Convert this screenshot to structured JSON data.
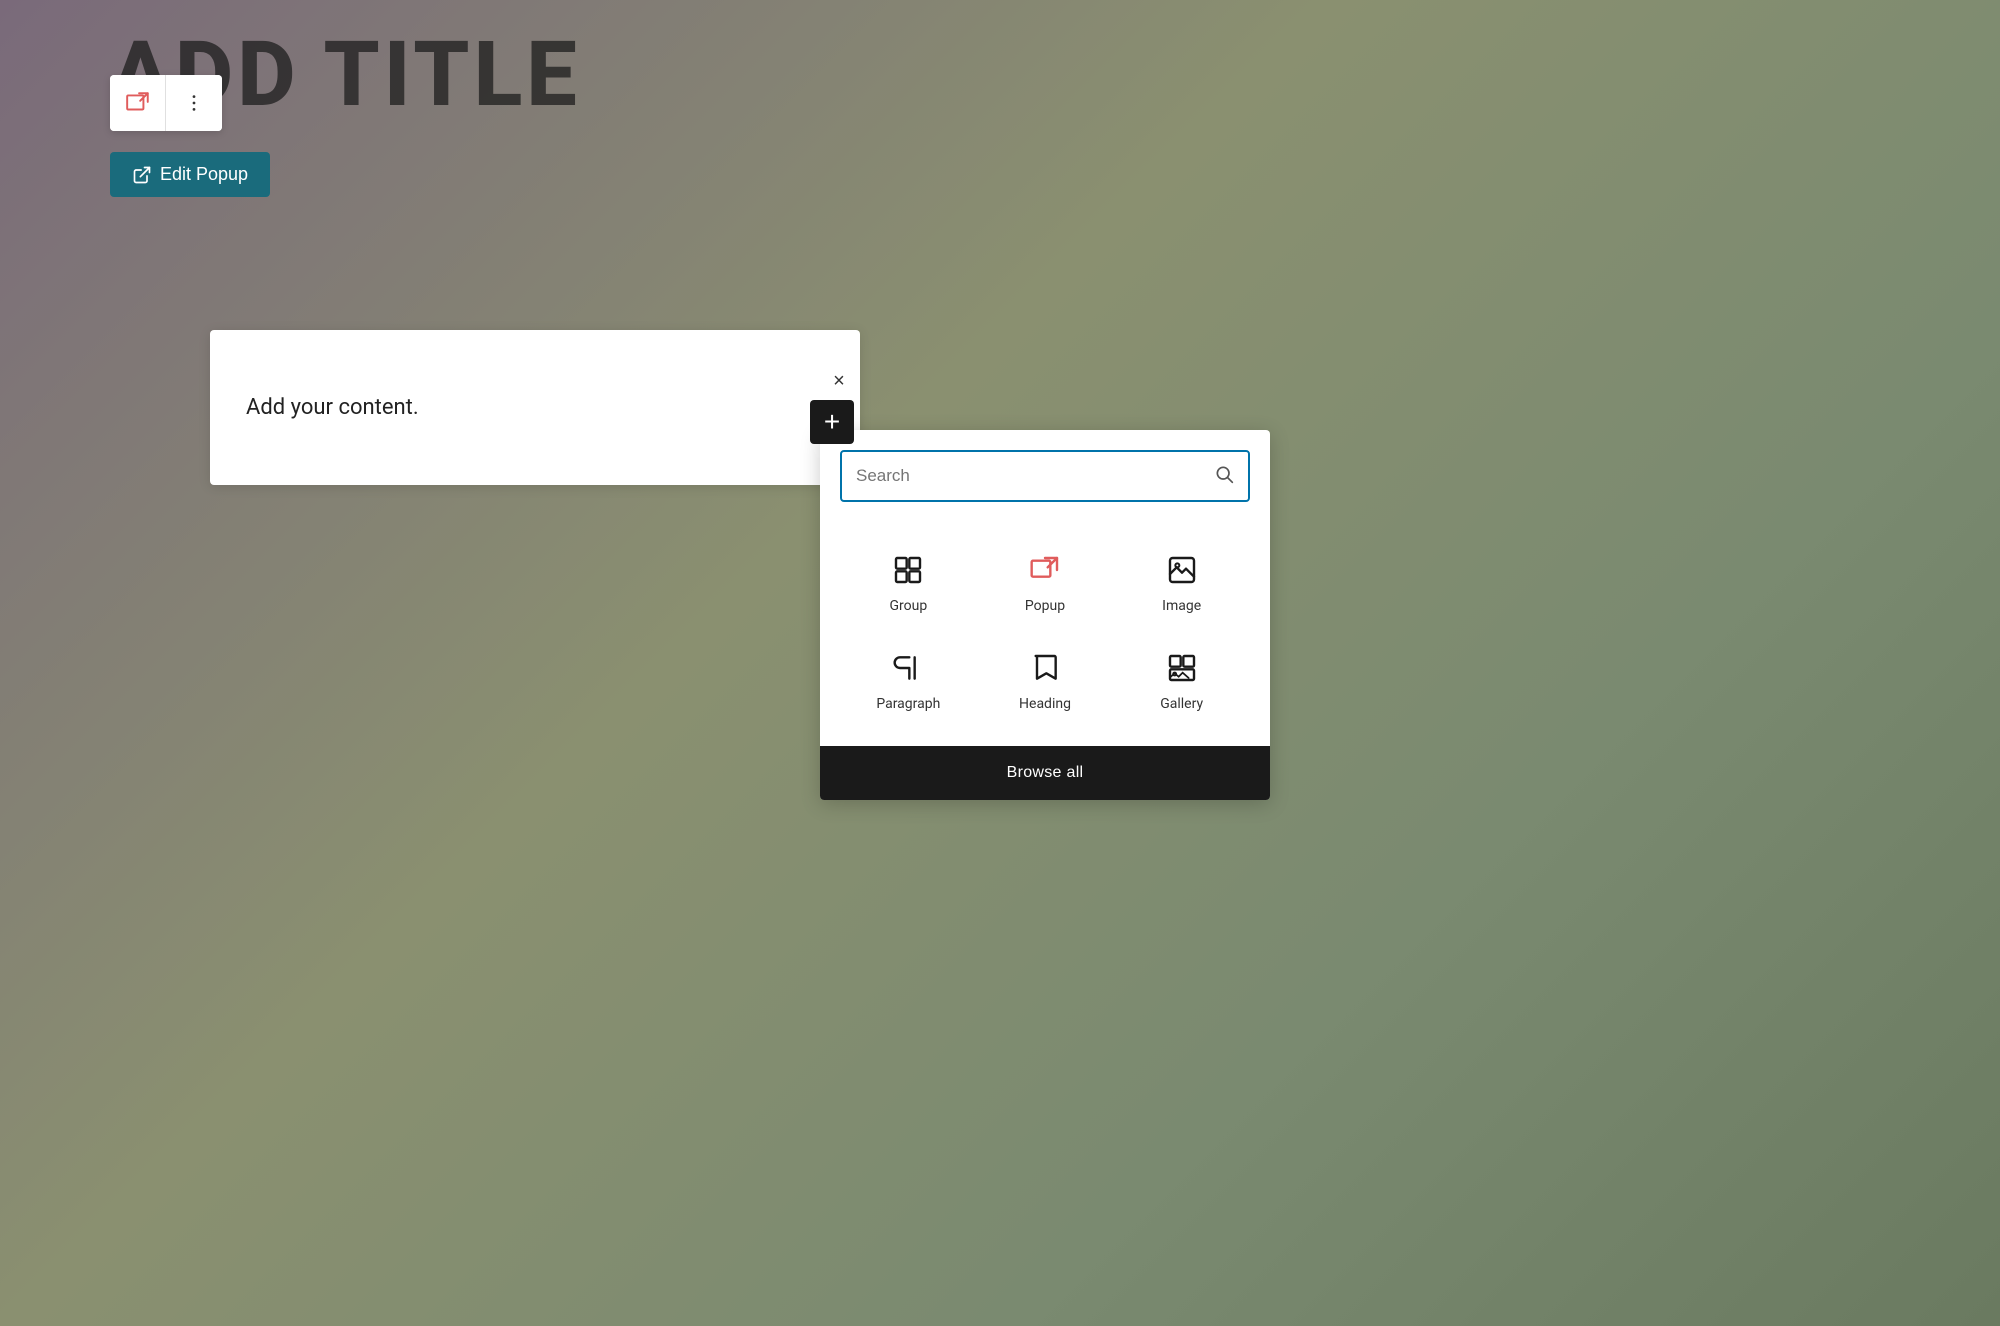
{
  "page": {
    "title": "ADD TITLE",
    "background": "muted green-gray gradient"
  },
  "toolbar": {
    "popup_btn_label": "Popup icon button",
    "more_btn_label": "More options"
  },
  "edit_popup": {
    "label": "Edit Popup",
    "icon": "external-link-icon"
  },
  "content_block": {
    "placeholder_text": "Add your content."
  },
  "close_btn": {
    "label": "×"
  },
  "add_btn": {
    "label": "+"
  },
  "inserter": {
    "search": {
      "placeholder": "Search",
      "icon": "search-icon"
    },
    "blocks": [
      {
        "id": "group",
        "label": "Group",
        "icon": "group-icon"
      },
      {
        "id": "popup",
        "label": "Popup",
        "icon": "popup-icon"
      },
      {
        "id": "image",
        "label": "Image",
        "icon": "image-icon"
      },
      {
        "id": "paragraph",
        "label": "Paragraph",
        "icon": "paragraph-icon"
      },
      {
        "id": "heading",
        "label": "Heading",
        "icon": "heading-icon"
      },
      {
        "id": "gallery",
        "label": "Gallery",
        "icon": "gallery-icon"
      }
    ],
    "browse_all_label": "Browse all"
  }
}
